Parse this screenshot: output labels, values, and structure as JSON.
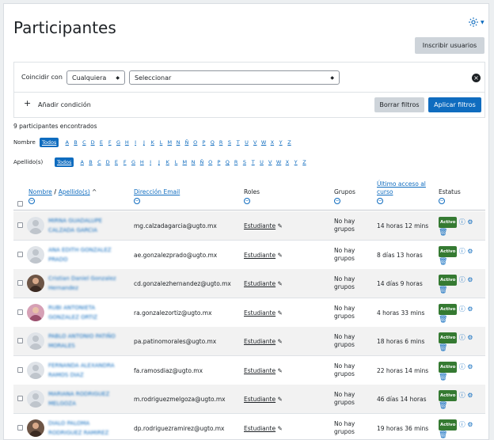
{
  "page": {
    "title": "Participantes",
    "enrol_button": "Inscribir usuarios"
  },
  "filter": {
    "match_label": "Coincidir con",
    "match_value": "Cualquiera",
    "select_value": "Seleccionar",
    "add_condition": "Añadir condición",
    "clear_button": "Borrar filtros",
    "apply_button": "Aplicar filtros"
  },
  "found_text": "9 participantes encontrados",
  "initials": {
    "nombre_label": "Nombre",
    "apellido_label": "Apellido(s)",
    "todos": "Todos",
    "letters": [
      "A",
      "B",
      "C",
      "D",
      "E",
      "F",
      "G",
      "H",
      "I",
      "J",
      "K",
      "L",
      "M",
      "N",
      "Ñ",
      "O",
      "P",
      "Q",
      "R",
      "S",
      "T",
      "U",
      "V",
      "W",
      "X",
      "Y",
      "Z"
    ]
  },
  "table": {
    "headers": {
      "nombre": "Nombre",
      "separator": " / ",
      "apellido": "Apellido(s)",
      "sort_arrow": "^",
      "email": "Dirección Email",
      "roles": "Roles",
      "grupos": "Grupos",
      "ultimo_line1": "Último acceso al",
      "ultimo_line2": "curso",
      "estatus": "Estatus"
    },
    "rows": [
      {
        "name_l1": "MIRNA GUADALUPE",
        "name_l2": "CALZADA GARCIA",
        "email": "mg.calzadagarcia@ugto.mx",
        "role": "Estudiante",
        "groups_l1": "No hay",
        "groups_l2": "grupos",
        "last": "14 horas 12 mins",
        "status": "Activo"
      },
      {
        "name_l1": "ANA EDITH GONZALEZ",
        "name_l2": "PRADO",
        "email": "ae.gonzalezprado@ugto.mx",
        "role": "Estudiante",
        "groups_l1": "No hay",
        "groups_l2": "grupos",
        "last": "8 días 13 horas",
        "status": "Activo"
      },
      {
        "name_l1": "Cristian Daniel Gonzalez",
        "name_l2": "Hernandez",
        "email": "cd.gonzalezhernandez@ugto.mx",
        "role": "Estudiante",
        "groups_l1": "No hay",
        "groups_l2": "grupos",
        "last": "14 días 9 horas",
        "status": "Activo"
      },
      {
        "name_l1": "RUBI ANTONIETA",
        "name_l2": "GONZALEZ ORTIZ",
        "email": "ra.gonzalezortiz@ugto.mx",
        "role": "Estudiante",
        "groups_l1": "No hay",
        "groups_l2": "grupos",
        "last": "4 horas 33 mins",
        "status": "Activo"
      },
      {
        "name_l1": "PABLO ANTONIO PATIÑO",
        "name_l2": "MORALES",
        "email": "pa.patinomorales@ugto.mx",
        "role": "Estudiante",
        "groups_l1": "No hay",
        "groups_l2": "grupos",
        "last": "18 horas 6 mins",
        "status": "Activo"
      },
      {
        "name_l1": "FERNANDA ALEXANDRA",
        "name_l2": "RAMOS DIAZ",
        "email": "fa.ramosdiaz@ugto.mx",
        "role": "Estudiante",
        "groups_l1": "No hay",
        "groups_l2": "grupos",
        "last": "22 horas 14 mins",
        "status": "Activo"
      },
      {
        "name_l1": "MARIANA RODRIGUEZ",
        "name_l2": "MELGOZA",
        "email": "m.rodriguezmelgoza@ugto.mx",
        "role": "Estudiante",
        "groups_l1": "No hay",
        "groups_l2": "grupos",
        "last": "46 días 14 horas",
        "status": "Activo"
      },
      {
        "name_l1": "DIALO PALOMA",
        "name_l2": "RODRIGUEZ RAMIREZ",
        "email": "dp.rodriguezramirez@ugto.mx",
        "role": "Estudiante",
        "groups_l1": "No hay",
        "groups_l2": "grupos",
        "last": "19 horas 36 mins",
        "status": "Activo"
      }
    ]
  },
  "icons": {
    "gear": "gear-icon",
    "close": "close-circle-icon",
    "plus": "plus-icon",
    "pencil": "pencil-icon",
    "info": "info-icon",
    "trash": "trash-icon",
    "settings": "settings-icon"
  },
  "colors": {
    "primary": "#0f6cbf",
    "active_badge": "#357a32"
  }
}
